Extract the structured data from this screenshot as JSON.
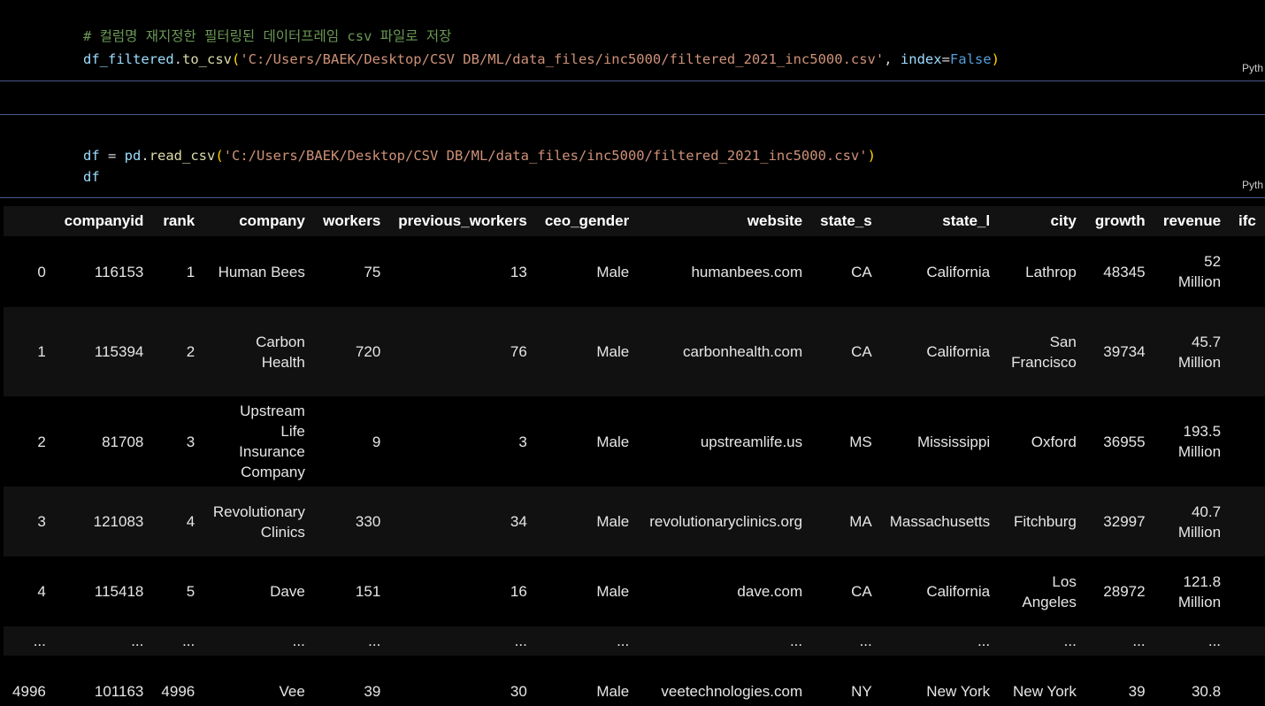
{
  "cell1": {
    "comment": "# 컬럼명 재지정한 필터링된 데이터프레임 csv 파일로 저장",
    "code": {
      "obj": "df_filtered",
      "dot": ".",
      "method": "to_csv",
      "open": "(",
      "path": "'C:/Users/BAEK/Desktop/CSV DB/ML/data_files/inc5000/filtered_2021_inc5000.csv'",
      "comma": ", ",
      "kwarg": "index",
      "eq": "=",
      "val": "False",
      "close": ")"
    },
    "lang": "Pyth"
  },
  "cell2": {
    "code": {
      "var": "df",
      "assign": " = ",
      "module": "pd",
      "dot": ".",
      "func": "read_csv",
      "open": "(",
      "path": "'C:/Users/BAEK/Desktop/CSV DB/ML/data_files/inc5000/filtered_2021_inc5000.csv'",
      "close": ")"
    },
    "line2": "df",
    "lang": "Pyth"
  },
  "table": {
    "columns": [
      "",
      "companyid",
      "rank",
      "company",
      "workers",
      "previous_workers",
      "ceo_gender",
      "website",
      "state_s",
      "state_l",
      "city",
      "growth",
      "revenue",
      "ifc"
    ],
    "rows": [
      [
        "0",
        "116153",
        "1",
        "Human Bees",
        "75",
        "13",
        "Male",
        "humanbees.com",
        "CA",
        "California",
        "Lathrop",
        "48345",
        "52 Million",
        ""
      ],
      [
        "1",
        "115394",
        "2",
        "Carbon Health",
        "720",
        "76",
        "Male",
        "carbonhealth.com",
        "CA",
        "California",
        "San Francisco",
        "39734",
        "45.7 Million",
        ""
      ],
      [
        "2",
        "81708",
        "3",
        "Upstream Life Insurance Company",
        "9",
        "3",
        "Male",
        "upstreamlife.us",
        "MS",
        "Mississippi",
        "Oxford",
        "36955",
        "193.5 Million",
        ""
      ],
      [
        "3",
        "121083",
        "4",
        "Revolutionary Clinics",
        "330",
        "34",
        "Male",
        "revolutionaryclinics.org",
        "MA",
        "Massachusetts",
        "Fitchburg",
        "32997",
        "40.7 Million",
        ""
      ],
      [
        "4",
        "115418",
        "5",
        "Dave",
        "151",
        "16",
        "Male",
        "dave.com",
        "CA",
        "California",
        "Los Angeles",
        "28972",
        "121.8 Million",
        ""
      ],
      [
        "...",
        "...",
        "...",
        "...",
        "...",
        "...",
        "...",
        "...",
        "...",
        "...",
        "...",
        "...",
        "...",
        ""
      ],
      [
        "4996",
        "101163",
        "4996",
        "Vee",
        "39",
        "30",
        "Male",
        "veetechnologies.com",
        "NY",
        "New York",
        "New York",
        "39",
        "30.8",
        ""
      ]
    ]
  }
}
